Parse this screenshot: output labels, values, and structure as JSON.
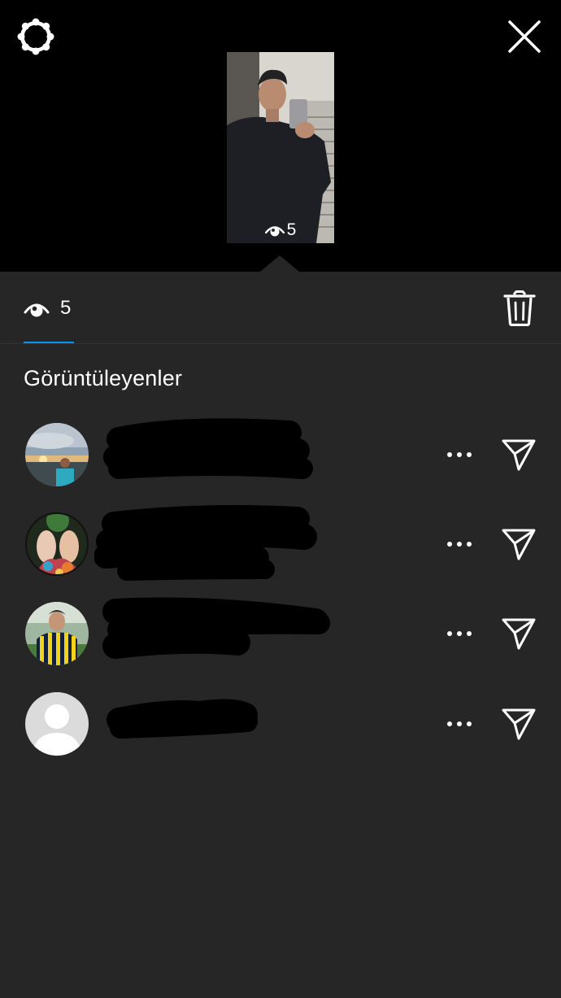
{
  "header": {
    "settings_icon": "gear-icon",
    "close_icon": "close-icon"
  },
  "story": {
    "preview_views": "5"
  },
  "stats": {
    "view_count": "5",
    "delete_icon": "trash-icon"
  },
  "viewers_section": {
    "title": "Görüntüleyenler"
  },
  "viewers": [
    {
      "avatar": "sunset-photo",
      "more_icon": "more-icon",
      "send_icon": "send-icon"
    },
    {
      "avatar": "floral-photo",
      "more_icon": "more-icon",
      "send_icon": "send-icon"
    },
    {
      "avatar": "jersey-photo",
      "more_icon": "more-icon",
      "send_icon": "send-icon"
    },
    {
      "avatar": "default-avatar",
      "more_icon": "more-icon",
      "send_icon": "send-icon"
    }
  ],
  "colors": {
    "background": "#262626",
    "top_background": "#000000",
    "accent": "#0095f6"
  }
}
